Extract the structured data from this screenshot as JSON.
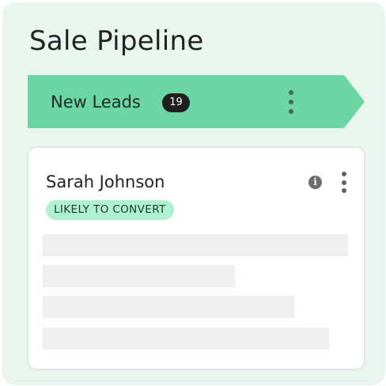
{
  "board": {
    "title": "Sale Pipeline"
  },
  "stage": {
    "label": "New Leads",
    "count": "19",
    "menu_icon": "vertical-dots-icon"
  },
  "lead_card": {
    "name": "Sarah Johnson",
    "status": "LIKELY TO CONVERT",
    "info_icon": "info-icon",
    "info_glyph": "i",
    "menu_icon": "vertical-dots-icon"
  },
  "colors": {
    "panel_background": "#e9f6ee",
    "stage_header": "#6bd6a4",
    "count_badge": "#1f1f1f",
    "status_badge": "#aef0cf",
    "skeleton": "#efefef"
  }
}
